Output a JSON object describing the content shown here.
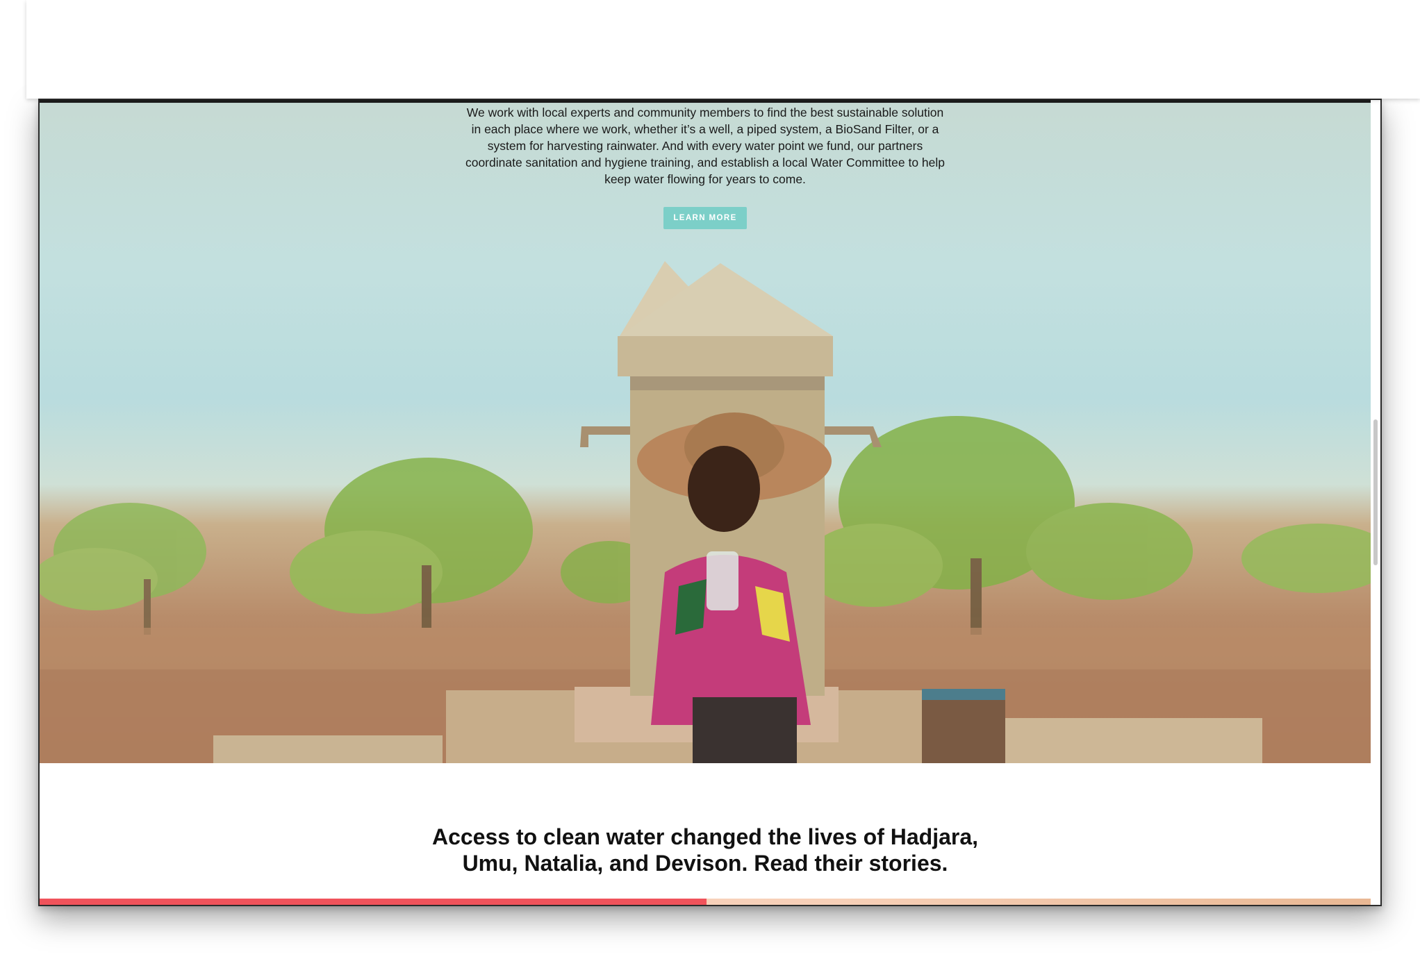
{
  "hero": {
    "paragraph": "We work with local experts and community members to find the best sustainable solution in each place where we work, whether it’s a well, a piped system, a BioSand Filter, or a system for harvesting rainwater. And with every water point we fund, our partners coordinate sanitation and hygiene training, and establish a local Water Committee to help keep water flowing for years to come.",
    "button_label": "LEARN MORE",
    "image_subject": "Child in straw hat holding a glass of water, seated in front of a water tap point"
  },
  "stories": {
    "heading_line1": "Access to clean water changed the lives of Hadjara,",
    "heading_line2": "Umu, Natalia, and Devison. Read their stories."
  },
  "colors": {
    "button": "#7ccfc8",
    "accent_red": "#f0535b",
    "text": "#111111"
  }
}
